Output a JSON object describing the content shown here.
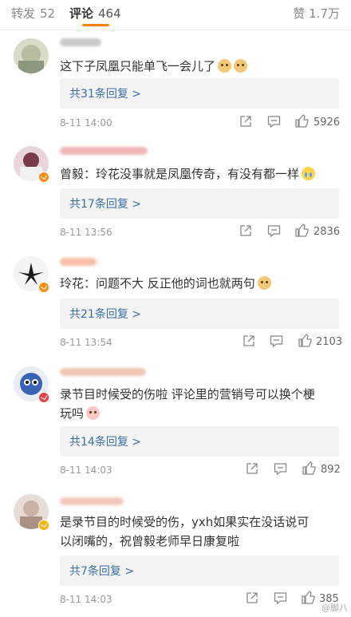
{
  "tabs": {
    "forward": {
      "label": "转发",
      "count": "52"
    },
    "comments": {
      "label": "评论",
      "count": "464"
    },
    "likes": {
      "label": "赞",
      "count": "1.7万"
    }
  },
  "comments": [
    {
      "text": "这下子凤凰只能单飞一会儿了",
      "emoji": [
        "doge-icon",
        "doge-icon"
      ],
      "replies": "共31条回复 >",
      "time": "8-11 14:00",
      "likes": "5926"
    },
    {
      "text": "曾毅：玲花没事就是凤凰传奇，有没有都一样",
      "emoji": [
        "crying-icon"
      ],
      "replies": "共17条回复 >",
      "time": "8-11 13:56",
      "likes": "2836"
    },
    {
      "text": "玲花：问题不大 反正他的词也就两句",
      "emoji": [
        "doge-icon"
      ],
      "replies": "共21条回复 >",
      "time": "8-11 13:54",
      "likes": "2103"
    },
    {
      "text_line1": "录节目时候受的伤啦 评论里的营销号可以换个梗",
      "text_line2": "玩吗",
      "emoji": [
        "pig-icon"
      ],
      "replies": "共14条回复 >",
      "time": "8-11 14:03",
      "likes": "892"
    },
    {
      "text_line1": "是录节目的时候受的伤，yxh如果实在没话说可",
      "text_line2": "以闭嘴的，祝曾毅老师早日康复啦",
      "replies": "共7条回复 >",
      "time": "8-11 14:03",
      "likes": "385"
    }
  ],
  "watermark": "@脚八",
  "colors": {
    "accent": "#ff8200",
    "link": "#3b6fab",
    "reply_bg": "#f3f3f3"
  }
}
